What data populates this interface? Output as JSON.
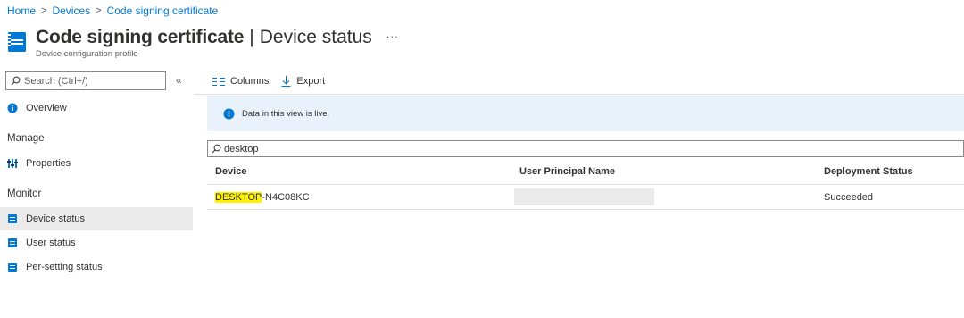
{
  "breadcrumb": {
    "items": [
      "Home",
      "Devices",
      "Code signing certificate"
    ],
    "separator": ">"
  },
  "header": {
    "title": "Code signing certificate",
    "title_separator": "|",
    "subtitle": "Device status",
    "more": "...",
    "profile_type": "Device configuration profile",
    "icon": "device-config-icon"
  },
  "sidebar": {
    "search_placeholder": "Search (Ctrl+/)",
    "collapse_label": "«",
    "overview_label": "Overview",
    "manage_section": "Manage",
    "properties_label": "Properties",
    "monitor_section": "Monitor",
    "device_status_label": "Device status",
    "user_status_label": "User status",
    "per_setting_status_label": "Per-setting status"
  },
  "toolbar": {
    "columns_label": "Columns",
    "export_label": "Export"
  },
  "info_bar": {
    "text": "Data in this view is live."
  },
  "filter": {
    "value": "desktop"
  },
  "table": {
    "headers": [
      "Device",
      "User Principal Name",
      "Deployment Status"
    ],
    "rows": [
      {
        "device_highlight": "DESKTOP",
        "device_rest": "-N4C08KC",
        "upn": "",
        "status": "Succeeded"
      }
    ]
  },
  "colors": {
    "accent": "#0078d4",
    "info_bg": "#e9f2fb",
    "selected_nav": "#ebebeb",
    "highlight": "#fff100"
  }
}
